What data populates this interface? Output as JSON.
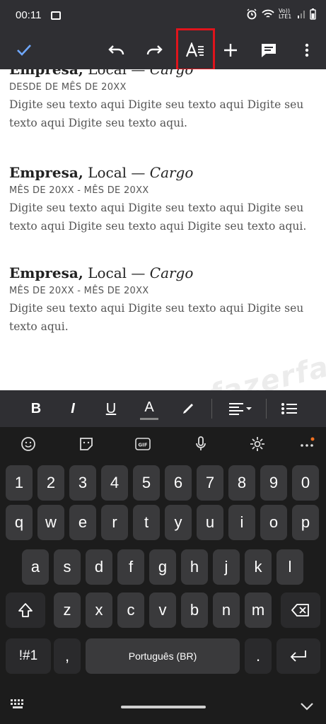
{
  "status": {
    "time": "00:11",
    "network": "Vo)) LTE1"
  },
  "toolbar": {
    "done_icon": "check-icon",
    "undo_icon": "undo-icon",
    "redo_icon": "redo-icon",
    "format_icon": "text-format-icon",
    "insert_icon": "plus-icon",
    "comment_icon": "comment-icon",
    "more_icon": "more-vert-icon",
    "highlight_color": "#e0141c"
  },
  "document": {
    "entries": [
      {
        "company": "Empresa,",
        "location": " Local — ",
        "role": "Cargo",
        "dates": "DESDE DE MÊS DE 20XX",
        "text": "Digite seu texto aqui Digite seu texto aqui Digite seu texto aqui Digite seu texto aqui."
      },
      {
        "company": "Empresa,",
        "location": " Local — ",
        "role": "Cargo",
        "dates": "MÊS DE 20XX - MÊS DE 20XX",
        "text": "Digite seu texto aqui Digite seu texto aqui Digite seu texto aqui Digite seu texto aqui Digite seu texto aqui."
      },
      {
        "company": "Empresa,",
        "location": " Local — ",
        "role": "Cargo",
        "dates": "MÊS DE 20XX - MÊS DE 20XX",
        "text": "Digite seu texto aqui Digite seu texto aqui Digite seu texto aqui."
      }
    ],
    "watermark": "www.comofazerfacil.com.br"
  },
  "format_bar": {
    "bold": "B",
    "italic": "I",
    "underline": "U",
    "text_color": "A"
  },
  "keyboard": {
    "numbers": [
      "1",
      "2",
      "3",
      "4",
      "5",
      "6",
      "7",
      "8",
      "9",
      "0"
    ],
    "row1": [
      "q",
      "w",
      "e",
      "r",
      "t",
      "y",
      "u",
      "i",
      "o",
      "p"
    ],
    "row2": [
      "a",
      "s",
      "d",
      "f",
      "g",
      "h",
      "j",
      "k",
      "l"
    ],
    "row3": [
      "z",
      "x",
      "c",
      "v",
      "b",
      "n",
      "m"
    ],
    "symbols_key": "!#1",
    "comma": ",",
    "space_label": "Português (BR)",
    "period": "."
  }
}
